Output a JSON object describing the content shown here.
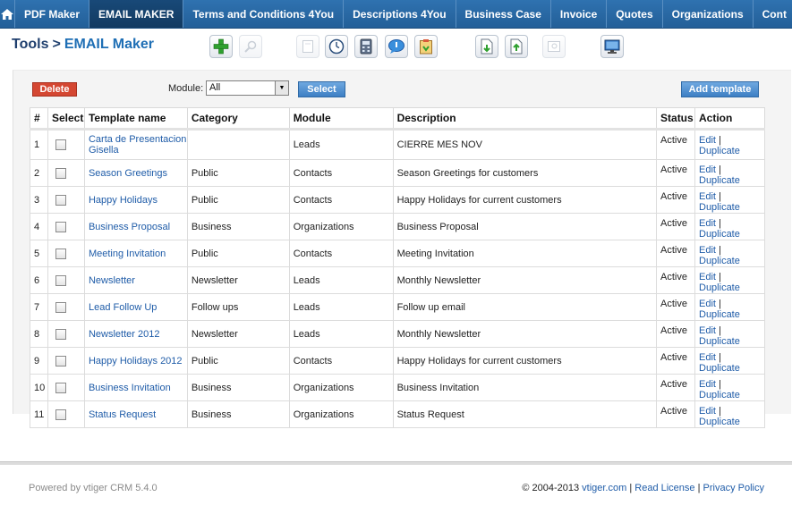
{
  "nav": {
    "tabs": [
      {
        "label": "PDF Maker",
        "active": false
      },
      {
        "label": "EMAIL MAKER",
        "active": true
      },
      {
        "label": "Terms and Conditions 4You",
        "active": false
      },
      {
        "label": "Descriptions 4You",
        "active": false
      },
      {
        "label": "Business Case",
        "active": false
      },
      {
        "label": "Invoice",
        "active": false
      },
      {
        "label": "Quotes",
        "active": false
      },
      {
        "label": "Organizations",
        "active": false
      },
      {
        "label": "Cont",
        "active": false
      }
    ]
  },
  "breadcrumb": {
    "parent": "Tools",
    "separator": ">",
    "current": "EMAIL Maker"
  },
  "toolbar": {
    "icons": [
      "add-icon",
      "search-icon",
      "import-icon",
      "clock-icon",
      "calculator-icon",
      "chat-icon",
      "clipboard-icon",
      "import-template-icon",
      "export-template-icon",
      "preview-icon",
      "monitor-icon"
    ]
  },
  "actions": {
    "delete_label": "Delete",
    "module_label": "Module:",
    "module_value": "All",
    "select_label": "Select",
    "add_template_label": "Add template"
  },
  "table": {
    "headers": {
      "num": "#",
      "select": "Select",
      "name": "Template name",
      "category": "Category",
      "module": "Module",
      "description": "Description",
      "status": "Status",
      "action": "Action"
    },
    "rows": [
      {
        "num": "1",
        "name": "Carta de Presentacion Gisella",
        "category": "",
        "module": "Leads",
        "description": "CIERRE MES NOV",
        "status": "Active"
      },
      {
        "num": "2",
        "name": "Season Greetings",
        "category": "Public",
        "module": "Contacts",
        "description": "Season Greetings for customers",
        "status": "Active"
      },
      {
        "num": "3",
        "name": "Happy Holidays",
        "category": "Public",
        "module": "Contacts",
        "description": "Happy Holidays for current customers",
        "status": "Active"
      },
      {
        "num": "4",
        "name": "Business Proposal",
        "category": "Business",
        "module": "Organizations",
        "description": "Business Proposal",
        "status": "Active"
      },
      {
        "num": "5",
        "name": "Meeting Invitation",
        "category": "Public",
        "module": "Contacts",
        "description": "Meeting Invitation",
        "status": "Active"
      },
      {
        "num": "6",
        "name": "Newsletter",
        "category": "Newsletter",
        "module": "Leads",
        "description": "Monthly Newsletter",
        "status": "Active"
      },
      {
        "num": "7",
        "name": "Lead Follow Up",
        "category": "Follow ups",
        "module": "Leads",
        "description": "Follow up email",
        "status": "Active"
      },
      {
        "num": "8",
        "name": "Newsletter 2012",
        "category": "Newsletter",
        "module": "Leads",
        "description": "Monthly Newsletter",
        "status": "Active"
      },
      {
        "num": "9",
        "name": "Happy Holidays 2012",
        "category": "Public",
        "module": "Contacts",
        "description": "Happy Holidays for current customers",
        "status": "Active"
      },
      {
        "num": "10",
        "name": "Business Invitation",
        "category": "Business",
        "module": "Organizations",
        "description": "Business Invitation",
        "status": "Active"
      },
      {
        "num": "11",
        "name": "Status Request",
        "category": "Business",
        "module": "Organizations",
        "description": "Status Request",
        "status": "Active"
      }
    ],
    "edit_label": "Edit",
    "action_sep": "|",
    "duplicate_label": "Duplicate"
  },
  "footer": {
    "powered": "Powered by vtiger CRM 5.4.0",
    "copyright": "© 2004-2013",
    "site_link": "vtiger.com",
    "sep": "|",
    "license_link": "Read License",
    "privacy_link": "Privacy Policy"
  }
}
